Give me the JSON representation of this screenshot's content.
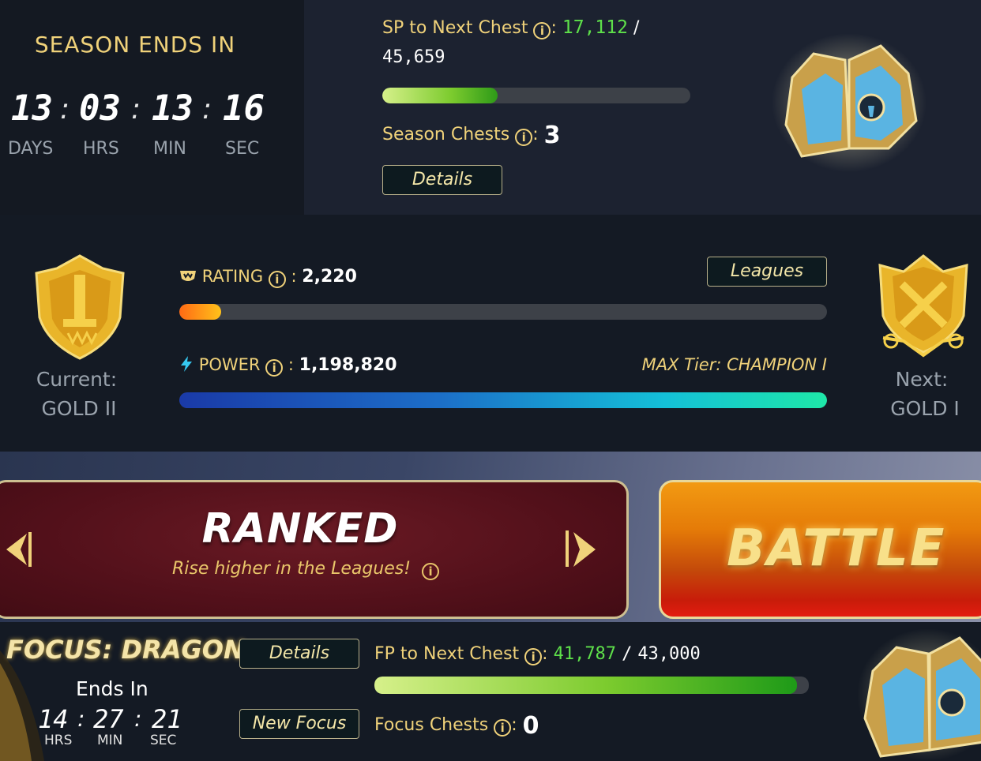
{
  "season": {
    "title": "SEASON ENDS IN",
    "countdown": {
      "days": "13",
      "hrs": "03",
      "min": "13",
      "sec": "16",
      "sep": ":"
    },
    "labels": {
      "days": "DAYS",
      "hrs": "HRS",
      "min": "MIN",
      "sec": "SEC"
    }
  },
  "sp": {
    "label": "SP to Next Chest",
    "current": "17,112",
    "slash": "/",
    "target": "45,659",
    "progress": 0.375,
    "chests_label": "Season Chests",
    "chests_value": "3",
    "details_label": "Details"
  },
  "league": {
    "current_label": "Current:",
    "current_tier": "GOLD II",
    "next_label": "Next:",
    "next_tier": "GOLD I",
    "rating_label": "RATING",
    "rating_value": "2,220",
    "rating_progress": 0.065,
    "leagues_label": "Leagues",
    "power_label": "POWER",
    "power_value": "1,198,820",
    "power_progress": 1.0,
    "max_tier": "MAX Tier: CHAMPION I"
  },
  "mode": {
    "title": "RANKED",
    "subtitle": "Rise higher in the Leagues!",
    "battle_label": "BATTLE"
  },
  "focus": {
    "title": "FOCUS: DRAGON",
    "ends_in_label": "Ends In",
    "countdown": {
      "hrs": "14",
      "min": "27",
      "sec": "21",
      "sep": ":"
    },
    "labels": {
      "hrs": "HRS",
      "min": "MIN",
      "sec": "SEC"
    },
    "details_label": "Details",
    "new_focus_label": "New Focus",
    "fp_label": "FP to Next Chest",
    "fp_current": "41,787",
    "fp_slash": "/",
    "fp_target": "43,000",
    "fp_progress": 0.972,
    "chests_label": "Focus Chests",
    "chests_value": "0"
  },
  "icons": {
    "info": "info-icon",
    "rating": "rating-crest-icon",
    "power": "lightning-icon",
    "prev": "arrow-left-icon",
    "next": "arrow-right-icon"
  },
  "colors": {
    "gold_text": "#f0d27a",
    "green_value": "#5ee04a",
    "battle_orange": "#e57b08",
    "ranked_red": "#52101a"
  }
}
